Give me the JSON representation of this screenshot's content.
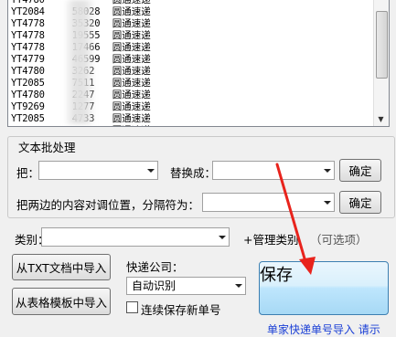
{
  "list": {
    "rows": [
      {
        "tracking": "YT4780",
        "tail": "",
        "carrier": "圆通速递"
      },
      {
        "tracking": "YT2084",
        "tail": "58028",
        "carrier": "圆通速递"
      },
      {
        "tracking": "YT4778",
        "tail": "35320",
        "carrier": "圆通速递"
      },
      {
        "tracking": "YT4778",
        "tail": "19555",
        "carrier": "圆通速递"
      },
      {
        "tracking": "YT4778",
        "tail": "17466",
        "carrier": "圆通速递"
      },
      {
        "tracking": "YT4779",
        "tail": "46599",
        "carrier": "圆通速递"
      },
      {
        "tracking": "YT4780",
        "tail": "3262",
        "carrier": "圆通速递"
      },
      {
        "tracking": "YT2085",
        "tail": "7511",
        "carrier": "圆通速递"
      },
      {
        "tracking": "YT4780",
        "tail": "2247",
        "carrier": "圆通速递"
      },
      {
        "tracking": "YT9269",
        "tail": "1277",
        "carrier": "圆通速递"
      },
      {
        "tracking": "YT2085",
        "tail": "4733",
        "carrier": "圆通速递"
      },
      {
        "tracking": "YT4780",
        "tail": "222",
        "carrier": "圆通速递"
      }
    ],
    "scroll_fraction": 0.1
  },
  "batch": {
    "title": "文本批处理",
    "replace_label": "把：",
    "replace_with_label": "替换成：",
    "confirm_label_1": "确定",
    "swap_label": "把两边的内容对调位置，分隔符为：",
    "confirm_label_2": "确定"
  },
  "category": {
    "label": "类别：",
    "manage_label": "+管理类别",
    "optional_hint": "（可选项）"
  },
  "import": {
    "txt_button": "从TXT文档中导入",
    "table_button": "从表格模板中导入"
  },
  "courier": {
    "label": "快递公司：",
    "selected": "自动识别",
    "continue_label": "连续保存新单号"
  },
  "save_label": "保存",
  "bottom_link": "单家快递单号导入 请示",
  "colors": {
    "arrow": "#e8231c",
    "link": "#1a3fd6",
    "save_border": "#3c7fb1"
  }
}
